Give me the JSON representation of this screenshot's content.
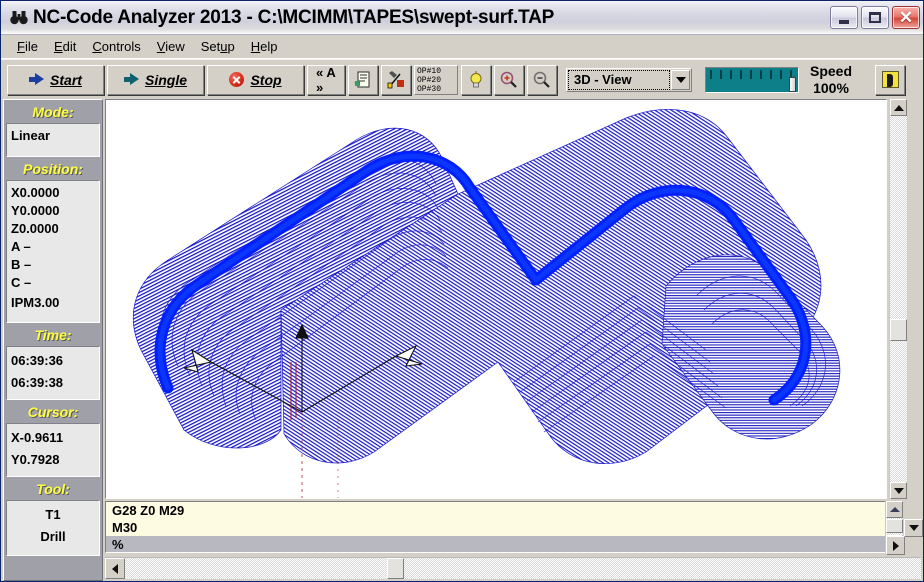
{
  "window": {
    "title": "NC-Code Analyzer 2013 - C:\\MCIMM\\TAPES\\swept-surf.TAP",
    "icon": "binoculars-icon",
    "minimize_label": "",
    "maximize_label": "",
    "close_label": "✕"
  },
  "menu": [
    {
      "name": "file",
      "pre": "",
      "acc": "F",
      "post": "ile"
    },
    {
      "name": "edit",
      "pre": "",
      "acc": "E",
      "post": "dit"
    },
    {
      "name": "controls",
      "pre": "",
      "acc": "C",
      "post": "ontrols"
    },
    {
      "name": "view",
      "pre": "",
      "acc": "V",
      "post": "iew"
    },
    {
      "name": "setup",
      "pre": "Set",
      "acc": "u",
      "post": "p"
    },
    {
      "name": "help",
      "pre": "",
      "acc": "H",
      "post": "elp"
    }
  ],
  "toolbar": {
    "start_label": "Start",
    "single_label": "Single",
    "stop_label": "Stop",
    "step_label": "« A »",
    "op_list": [
      "OP#10",
      "OP#20",
      "OP#30"
    ],
    "view_mode": "3D - View",
    "view_options": [
      "3D - View"
    ],
    "speed_title": "Speed",
    "speed_value": "100%",
    "speed_percent": 100
  },
  "sidebar": {
    "sections": [
      {
        "name": "mode",
        "header": "Mode:",
        "lines": [
          "Linear"
        ],
        "align": "left"
      },
      {
        "name": "position",
        "header": "Position:",
        "lines": [
          "X0.0000",
          "Y0.0000",
          "Z0.0000",
          "A –",
          "B –",
          "C –",
          "IPM3.00"
        ],
        "align": "left"
      },
      {
        "name": "time",
        "header": "Time:",
        "lines": [
          "06:39:36",
          "06:39:38"
        ],
        "align": "left"
      },
      {
        "name": "cursor",
        "header": "Cursor:",
        "lines": [
          "X-0.9611",
          "Y0.7928"
        ],
        "align": "left"
      },
      {
        "name": "tool",
        "header": "Tool:",
        "lines": [
          "T1",
          "Drill"
        ],
        "align": "center"
      }
    ]
  },
  "code": {
    "lines": [
      {
        "text": "G28 Z0 M29",
        "selected": false
      },
      {
        "text": "M30",
        "selected": false
      },
      {
        "text": "%",
        "selected": true
      }
    ]
  },
  "colors": {
    "toolpath": "#0000d8",
    "toolpath_active": "#0024ff",
    "axis_red": "#b02020",
    "sidebar_header": "#ffff40",
    "sidebar_bg": "#a0a0a8",
    "code_bg": "#fdfbe2",
    "code_selection": "#b8b8c0",
    "speed_bar": "#0d7f88",
    "window_chrome": "#d4d0c8"
  },
  "viewport": {
    "name": "toolpath-viewport",
    "background": "#ffffff",
    "axis_indicator": "3-axis-arrow-gizmo"
  }
}
